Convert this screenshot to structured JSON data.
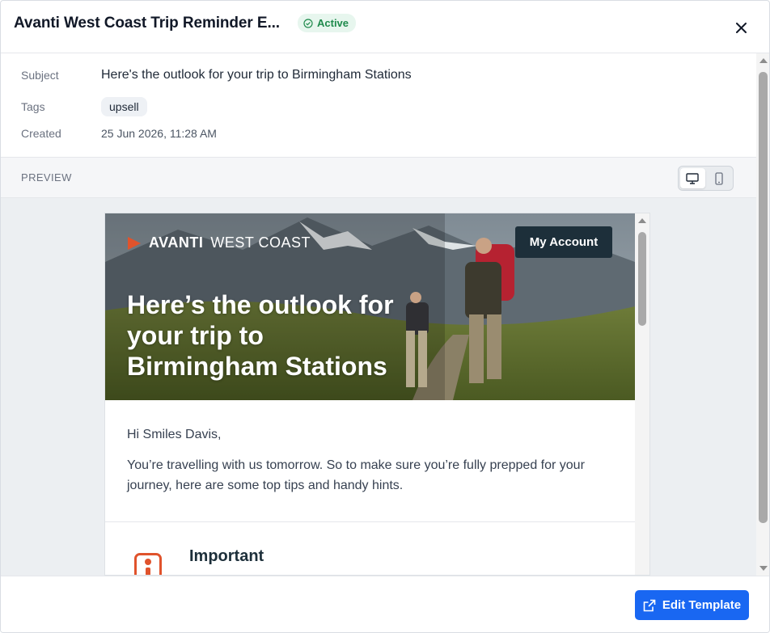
{
  "header": {
    "title": "Avanti West Coast Trip Reminder E...",
    "status": "Active",
    "close_icon": "close-icon"
  },
  "meta": {
    "subject_label": "Subject",
    "subject_value": "Here's the outlook for your trip to Birmingham Stations",
    "tags_label": "Tags",
    "tags": [
      "upsell"
    ],
    "created_label": "Created",
    "created_value": "25 Jun 2026, 11:28 AM"
  },
  "preview": {
    "label": "PREVIEW",
    "modes": [
      "desktop-icon",
      "mobile-icon"
    ],
    "active_mode": "desktop"
  },
  "email": {
    "brand_bold": "AVANTI",
    "brand_light": "WEST COAST",
    "account_button": "My Account",
    "hero_title": "Here’s the outlook for your trip to Birmingham Stations",
    "greeting": "Hi Smiles Davis,",
    "intro": "You’re travelling with us tomorrow. So to make sure you’re fully prepped for your journey, here are some top tips and handy hints.",
    "section_title": "Important"
  },
  "footer": {
    "edit_button": "Edit Template"
  },
  "colors": {
    "accent": "#1967f2",
    "status_bg": "#e7f6ee",
    "status_text": "#1f8a4c",
    "brand_orange": "#e0532c",
    "brand_dark": "#1d2f3a"
  }
}
